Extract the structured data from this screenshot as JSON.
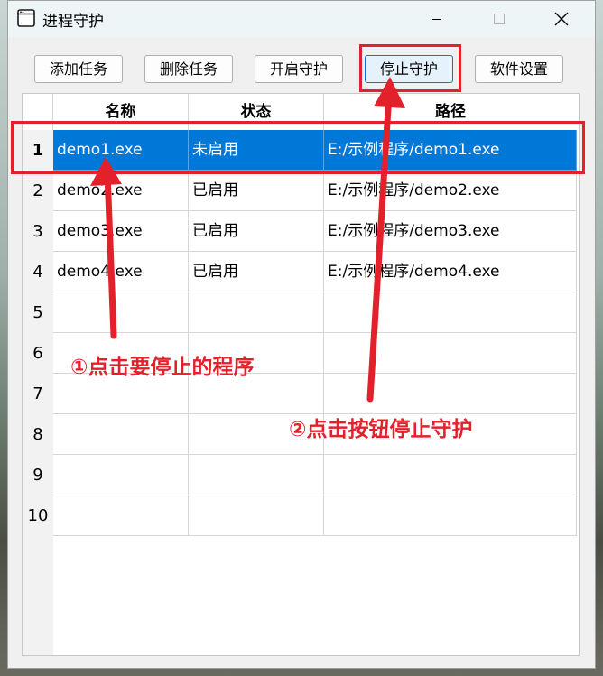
{
  "window": {
    "title": "进程守护"
  },
  "toolbar": {
    "add_task": "添加任务",
    "delete_task": "删除任务",
    "start_guard": "开启守护",
    "stop_guard": "停止守护",
    "settings": "软件设置"
  },
  "table": {
    "headers": [
      "名称",
      "状态",
      "路径"
    ],
    "rows": [
      {
        "num": "1",
        "name": "demo1.exe",
        "status": "未启用",
        "path": "E:/示例程序/demo1.exe",
        "selected": true
      },
      {
        "num": "2",
        "name": "demo2.exe",
        "status": "已启用",
        "path": "E:/示例程序/demo2.exe"
      },
      {
        "num": "3",
        "name": "demo3.exe",
        "status": "已启用",
        "path": "E:/示例程序/demo3.exe"
      },
      {
        "num": "4",
        "name": "demo4.exe",
        "status": "已启用",
        "path": "E:/示例程序/demo4.exe"
      },
      {
        "num": "5",
        "name": "",
        "status": "",
        "path": ""
      },
      {
        "num": "6",
        "name": "",
        "status": "",
        "path": ""
      },
      {
        "num": "7",
        "name": "",
        "status": "",
        "path": ""
      },
      {
        "num": "8",
        "name": "",
        "status": "",
        "path": ""
      },
      {
        "num": "9",
        "name": "",
        "status": "",
        "path": ""
      },
      {
        "num": "10",
        "name": "",
        "status": "",
        "path": ""
      }
    ]
  },
  "annotations": {
    "step1": "①点击要停止的程序",
    "step2": "②点击按钮停止守护",
    "color": "#e3212b"
  },
  "colors": {
    "selection": "#0078d7"
  }
}
